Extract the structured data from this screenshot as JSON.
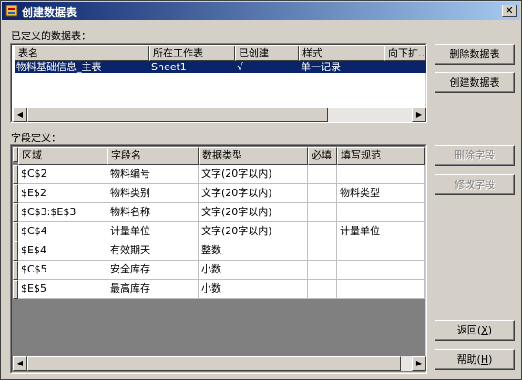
{
  "window": {
    "title": "创建数据表",
    "close_glyph": "✕"
  },
  "defined_tables": {
    "label": "已定义的数据表：",
    "columns": [
      "表名",
      "所在工作表",
      "已创建",
      "样式",
      "向下扩..."
    ],
    "rows": [
      {
        "name": "物料基础信息_主表",
        "sheet": "Sheet1",
        "created": "√",
        "style": "单一记录",
        "expand": ""
      }
    ],
    "selected_row": 0
  },
  "fields": {
    "label": "字段定义：",
    "columns": [
      "区域",
      "字段名",
      "数据类型",
      "必填",
      "填写规范"
    ],
    "rows": [
      {
        "area": "$C$2",
        "name": "物料编号",
        "type": "文字(20字以内)",
        "required": "",
        "rule": ""
      },
      {
        "area": "$E$2",
        "name": "物料类别",
        "type": "文字(20字以内)",
        "required": "",
        "rule": "物料类型"
      },
      {
        "area": "$C$3:$E$3",
        "name": "物料名称",
        "type": "文字(20字以内)",
        "required": "",
        "rule": ""
      },
      {
        "area": "$C$4",
        "name": "计量单位",
        "type": "文字(20字以内)",
        "required": "",
        "rule": "计量单位"
      },
      {
        "area": "$E$4",
        "name": "有效期天",
        "type": "整数",
        "required": "",
        "rule": ""
      },
      {
        "area": "$C$5",
        "name": "安全库存",
        "type": "小数",
        "required": "",
        "rule": ""
      },
      {
        "area": "$E$5",
        "name": "最高库存",
        "type": "小数",
        "required": "",
        "rule": ""
      }
    ]
  },
  "buttons": {
    "delete_table": "删除数据表",
    "create_table": "创建数据表",
    "delete_field": "删除字段",
    "edit_field": "修改字段",
    "back_label": "返回(",
    "back_key": "X",
    "back_end": ")",
    "help_label": "帮助(",
    "help_key": "H",
    "help_end": ")"
  },
  "colors": {
    "selection": "#0a246a",
    "grid_empty": "#808080"
  }
}
